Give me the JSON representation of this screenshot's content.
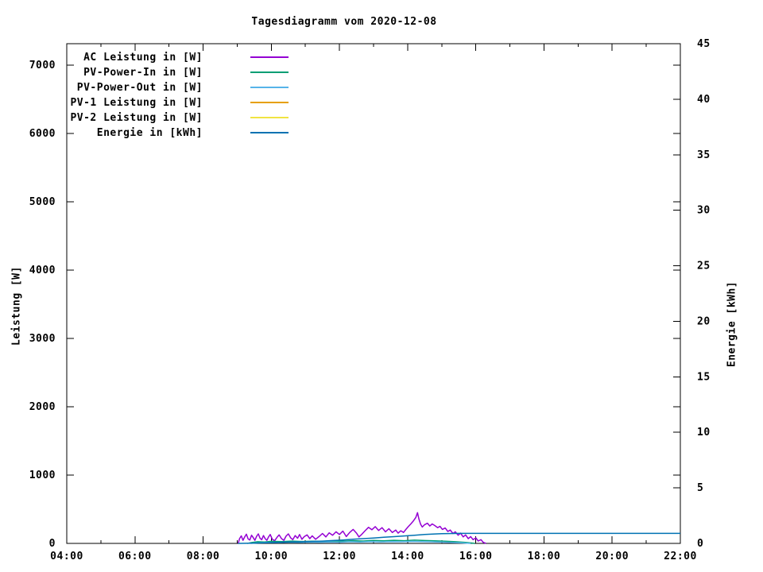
{
  "chart_data": {
    "type": "line",
    "title": "Tagesdiagramm vom 2020-12-08",
    "x_axis": {
      "range_hours": [
        4,
        22
      ],
      "ticks_major": [
        "04:00",
        "06:00",
        "08:00",
        "10:00",
        "12:00",
        "14:00",
        "16:00",
        "18:00",
        "20:00",
        "22:00"
      ],
      "tick_hours_major": [
        4,
        6,
        8,
        10,
        12,
        14,
        16,
        18,
        20,
        22
      ],
      "tick_hours_minor": [
        5,
        7,
        9,
        11,
        13,
        15,
        17,
        19,
        21
      ]
    },
    "y_left": {
      "label": "Leistung [W]",
      "ticks": [
        0,
        1000,
        2000,
        3000,
        4000,
        5000,
        6000,
        7000
      ],
      "range": [
        0,
        7320
      ]
    },
    "y_right": {
      "label": "Energie [kWh]",
      "ticks": [
        0,
        5,
        10,
        15,
        20,
        25,
        30,
        35,
        40,
        45
      ],
      "range": [
        0,
        45
      ]
    },
    "grid": "off",
    "legend_position": "top-left-inside",
    "series": [
      {
        "name": "AC Leistung in [W]",
        "color": "#9400d3",
        "axis": "left",
        "points": [
          [
            9.03,
            0
          ],
          [
            9.07,
            70
          ],
          [
            9.12,
            110
          ],
          [
            9.17,
            45
          ],
          [
            9.22,
            95
          ],
          [
            9.27,
            135
          ],
          [
            9.32,
            65
          ],
          [
            9.37,
            50
          ],
          [
            9.42,
            120
          ],
          [
            9.47,
            85
          ],
          [
            9.52,
            45
          ],
          [
            9.57,
            105
          ],
          [
            9.62,
            140
          ],
          [
            9.67,
            75
          ],
          [
            9.72,
            55
          ],
          [
            9.77,
            115
          ],
          [
            9.82,
            70
          ],
          [
            9.87,
            45
          ],
          [
            9.92,
            95
          ],
          [
            9.97,
            130
          ],
          [
            10.03,
            60
          ],
          [
            10.1,
            40
          ],
          [
            10.17,
            90
          ],
          [
            10.23,
            125
          ],
          [
            10.3,
            70
          ],
          [
            10.37,
            45
          ],
          [
            10.43,
            105
          ],
          [
            10.5,
            140
          ],
          [
            10.57,
            80
          ],
          [
            10.63,
            55
          ],
          [
            10.7,
            115
          ],
          [
            10.77,
            75
          ],
          [
            10.83,
            130
          ],
          [
            10.9,
            60
          ],
          [
            10.97,
            100
          ],
          [
            11.05,
            125
          ],
          [
            11.13,
            70
          ],
          [
            11.2,
            110
          ],
          [
            11.3,
            60
          ],
          [
            11.4,
            100
          ],
          [
            11.5,
            145
          ],
          [
            11.6,
            95
          ],
          [
            11.7,
            155
          ],
          [
            11.8,
            120
          ],
          [
            11.9,
            170
          ],
          [
            12.0,
            130
          ],
          [
            12.1,
            180
          ],
          [
            12.2,
            100
          ],
          [
            12.3,
            160
          ],
          [
            12.4,
            205
          ],
          [
            12.5,
            150
          ],
          [
            12.57,
            95
          ],
          [
            12.65,
            130
          ],
          [
            12.75,
            185
          ],
          [
            12.85,
            235
          ],
          [
            12.95,
            200
          ],
          [
            13.05,
            245
          ],
          [
            13.15,
            190
          ],
          [
            13.25,
            230
          ],
          [
            13.35,
            170
          ],
          [
            13.45,
            215
          ],
          [
            13.55,
            160
          ],
          [
            13.65,
            195
          ],
          [
            13.72,
            150
          ],
          [
            13.8,
            185
          ],
          [
            13.88,
            160
          ],
          [
            13.95,
            205
          ],
          [
            14.02,
            245
          ],
          [
            14.1,
            290
          ],
          [
            14.17,
            330
          ],
          [
            14.24,
            380
          ],
          [
            14.29,
            450
          ],
          [
            14.33,
            360
          ],
          [
            14.38,
            280
          ],
          [
            14.43,
            240
          ],
          [
            14.5,
            275
          ],
          [
            14.58,
            295
          ],
          [
            14.65,
            255
          ],
          [
            14.72,
            285
          ],
          [
            14.8,
            260
          ],
          [
            14.88,
            230
          ],
          [
            14.95,
            250
          ],
          [
            15.02,
            205
          ],
          [
            15.1,
            225
          ],
          [
            15.18,
            175
          ],
          [
            15.25,
            195
          ],
          [
            15.33,
            145
          ],
          [
            15.4,
            170
          ],
          [
            15.48,
            120
          ],
          [
            15.55,
            150
          ],
          [
            15.63,
            95
          ],
          [
            15.7,
            125
          ],
          [
            15.78,
            70
          ],
          [
            15.85,
            100
          ],
          [
            15.92,
            55
          ],
          [
            16.0,
            80
          ],
          [
            16.07,
            35
          ],
          [
            16.15,
            55
          ],
          [
            16.22,
            15
          ],
          [
            16.3,
            0
          ]
        ]
      },
      {
        "name": "PV-Power-In in [W]",
        "color": "#009e73",
        "axis": "left",
        "points": [
          [
            9.3,
            0
          ],
          [
            9.45,
            15
          ],
          [
            9.6,
            25
          ],
          [
            9.8,
            20
          ],
          [
            10.0,
            30
          ],
          [
            10.3,
            26
          ],
          [
            10.6,
            34
          ],
          [
            10.9,
            28
          ],
          [
            11.2,
            33
          ],
          [
            11.5,
            30
          ],
          [
            11.8,
            36
          ],
          [
            12.1,
            32
          ],
          [
            12.4,
            40
          ],
          [
            12.7,
            35
          ],
          [
            13.0,
            44
          ],
          [
            13.3,
            38
          ],
          [
            13.6,
            45
          ],
          [
            13.9,
            40
          ],
          [
            14.2,
            48
          ],
          [
            14.5,
            42
          ],
          [
            14.8,
            38
          ],
          [
            15.1,
            32
          ],
          [
            15.4,
            24
          ],
          [
            15.7,
            14
          ],
          [
            15.9,
            5
          ],
          [
            15.97,
            0
          ]
        ]
      },
      {
        "name": "PV-Power-Out in [W]",
        "color": "#56b4e9",
        "axis": "left",
        "points": [
          [
            9.4,
            0
          ],
          [
            9.6,
            8
          ],
          [
            9.9,
            14
          ],
          [
            10.2,
            12
          ],
          [
            10.5,
            17
          ],
          [
            10.8,
            14
          ],
          [
            11.1,
            19
          ],
          [
            11.4,
            16
          ],
          [
            11.7,
            21
          ],
          [
            12.0,
            18
          ],
          [
            12.3,
            24
          ],
          [
            12.6,
            20
          ],
          [
            12.9,
            26
          ],
          [
            13.2,
            22
          ],
          [
            13.5,
            27
          ],
          [
            13.8,
            24
          ],
          [
            14.1,
            29
          ],
          [
            14.4,
            26
          ],
          [
            14.7,
            23
          ],
          [
            15.0,
            19
          ],
          [
            15.3,
            13
          ],
          [
            15.6,
            7
          ],
          [
            15.85,
            0
          ]
        ]
      },
      {
        "name": "PV-1 Leistung in [W]",
        "color": "#e69f00",
        "axis": "left",
        "points": []
      },
      {
        "name": "PV-2 Leistung in [W]",
        "color": "#f0e442",
        "axis": "left",
        "points": []
      },
      {
        "name": "Energie in [kWh]",
        "color": "#0072b2",
        "axis": "right",
        "points": [
          [
            9.03,
            0
          ],
          [
            9.5,
            0.03
          ],
          [
            10.0,
            0.07
          ],
          [
            10.5,
            0.12
          ],
          [
            11.0,
            0.16
          ],
          [
            11.5,
            0.21
          ],
          [
            11.8,
            0.26
          ],
          [
            12.1,
            0.31
          ],
          [
            12.4,
            0.37
          ],
          [
            12.7,
            0.43
          ],
          [
            13.0,
            0.49
          ],
          [
            13.3,
            0.55
          ],
          [
            13.6,
            0.61
          ],
          [
            13.9,
            0.67
          ],
          [
            14.2,
            0.74
          ],
          [
            14.5,
            0.8
          ],
          [
            14.8,
            0.85
          ],
          [
            15.0,
            0.87
          ],
          [
            15.2,
            0.89
          ],
          [
            15.5,
            0.9
          ],
          [
            22.0,
            0.9
          ]
        ]
      }
    ],
    "colors": {
      "foreground": "#000000",
      "background": "#ffffff"
    }
  }
}
